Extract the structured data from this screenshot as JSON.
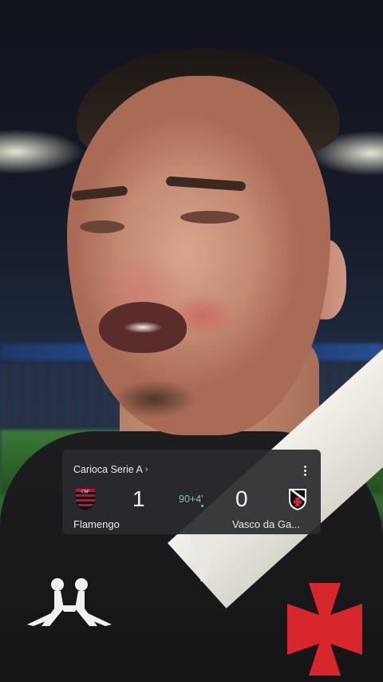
{
  "match": {
    "competition": "Carioca Serie A",
    "chevron": "›",
    "more_icon": "more-vert-icon",
    "status_time": "90+4'",
    "status_color": "#81c995",
    "home": {
      "name": "Flamengo",
      "score": "1",
      "crest_icon": "flamengo-crest-icon",
      "colors": [
        "#c8102e",
        "#111111"
      ]
    },
    "away": {
      "name": "Vasco da Ga...",
      "score": "0",
      "crest_icon": "vasco-crest-icon",
      "colors": [
        "#111111",
        "#ffffff"
      ]
    }
  },
  "photo": {
    "subject": "player-closeup-photo",
    "kit_logo_icon": "kappa-logo-icon",
    "badge_icon": "maltese-cross-icon"
  }
}
